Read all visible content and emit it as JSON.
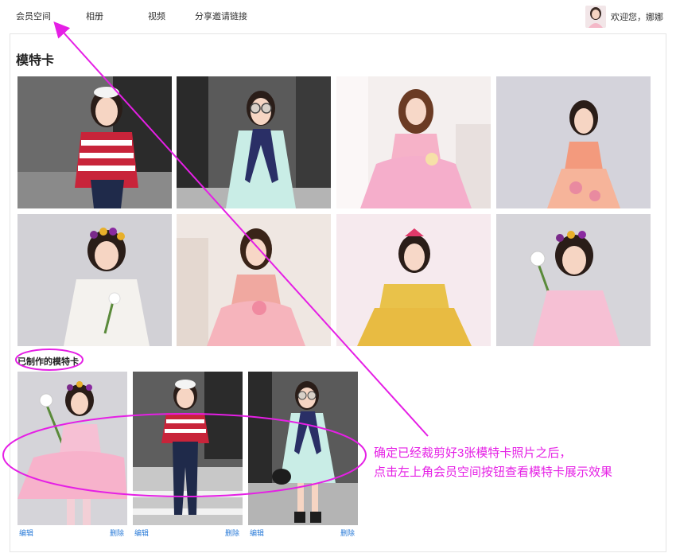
{
  "nav": {
    "items": [
      "会员空间",
      "相册",
      "视频",
      "分享邀请链接"
    ],
    "welcome": "欢迎您，娜娜"
  },
  "panel": {
    "title": "模特卡",
    "made_title": "已制作的模特卡"
  },
  "made_cards": [
    {
      "edit": "编辑",
      "delete": "删除"
    },
    {
      "edit": "编辑",
      "delete": "删除"
    },
    {
      "edit": "编辑",
      "delete": "删除"
    }
  ],
  "annotation": {
    "line1": "确定已经裁剪好3张模特卡照片之后，",
    "line2": "点击左上角会员空间按钮查看模特卡展示效果"
  },
  "colors": {
    "annotation": "#e51fe5",
    "link": "#2a7bd8"
  }
}
